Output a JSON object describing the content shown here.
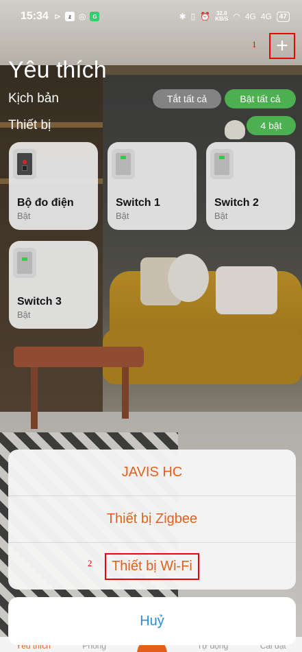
{
  "status_bar": {
    "time": "15:34",
    "net_speed_value": "32.0",
    "net_speed_unit": "KB/S",
    "signal1": "4G",
    "signal2": "4G",
    "battery": "47"
  },
  "header": {
    "title": "Yêu thích",
    "add_button": "+",
    "annotation_1": "1"
  },
  "scenes": {
    "label": "Kịch bản",
    "all_off": "Tắt tất cả",
    "all_on": "Bật tất cả"
  },
  "devices": {
    "label": "Thiết bị",
    "on_count": "4 bật",
    "items": [
      {
        "name": "Bộ đo điện",
        "state": "Bật",
        "icon": "power-meter-icon"
      },
      {
        "name": "Switch 1",
        "state": "Bật",
        "icon": "switch-icon"
      },
      {
        "name": "Switch 2",
        "state": "Bật",
        "icon": "switch-icon"
      },
      {
        "name": "Switch 3",
        "state": "Bật",
        "icon": "switch-icon"
      }
    ]
  },
  "action_sheet": {
    "options": [
      "JAVIS HC",
      "Thiết bị Zigbee",
      "Thiết bị Wi-Fi"
    ],
    "annotation_2": "2",
    "cancel": "Huỷ"
  },
  "bottom_nav": {
    "items": [
      "Yêu thích",
      "Phòng",
      "Tự động",
      "Cài đặt"
    ]
  },
  "colors": {
    "accent_orange": "#e2601c",
    "cancel_blue": "#2a8bd8",
    "green_pill": "#4caf50",
    "annotation_red": "#ee0000"
  }
}
